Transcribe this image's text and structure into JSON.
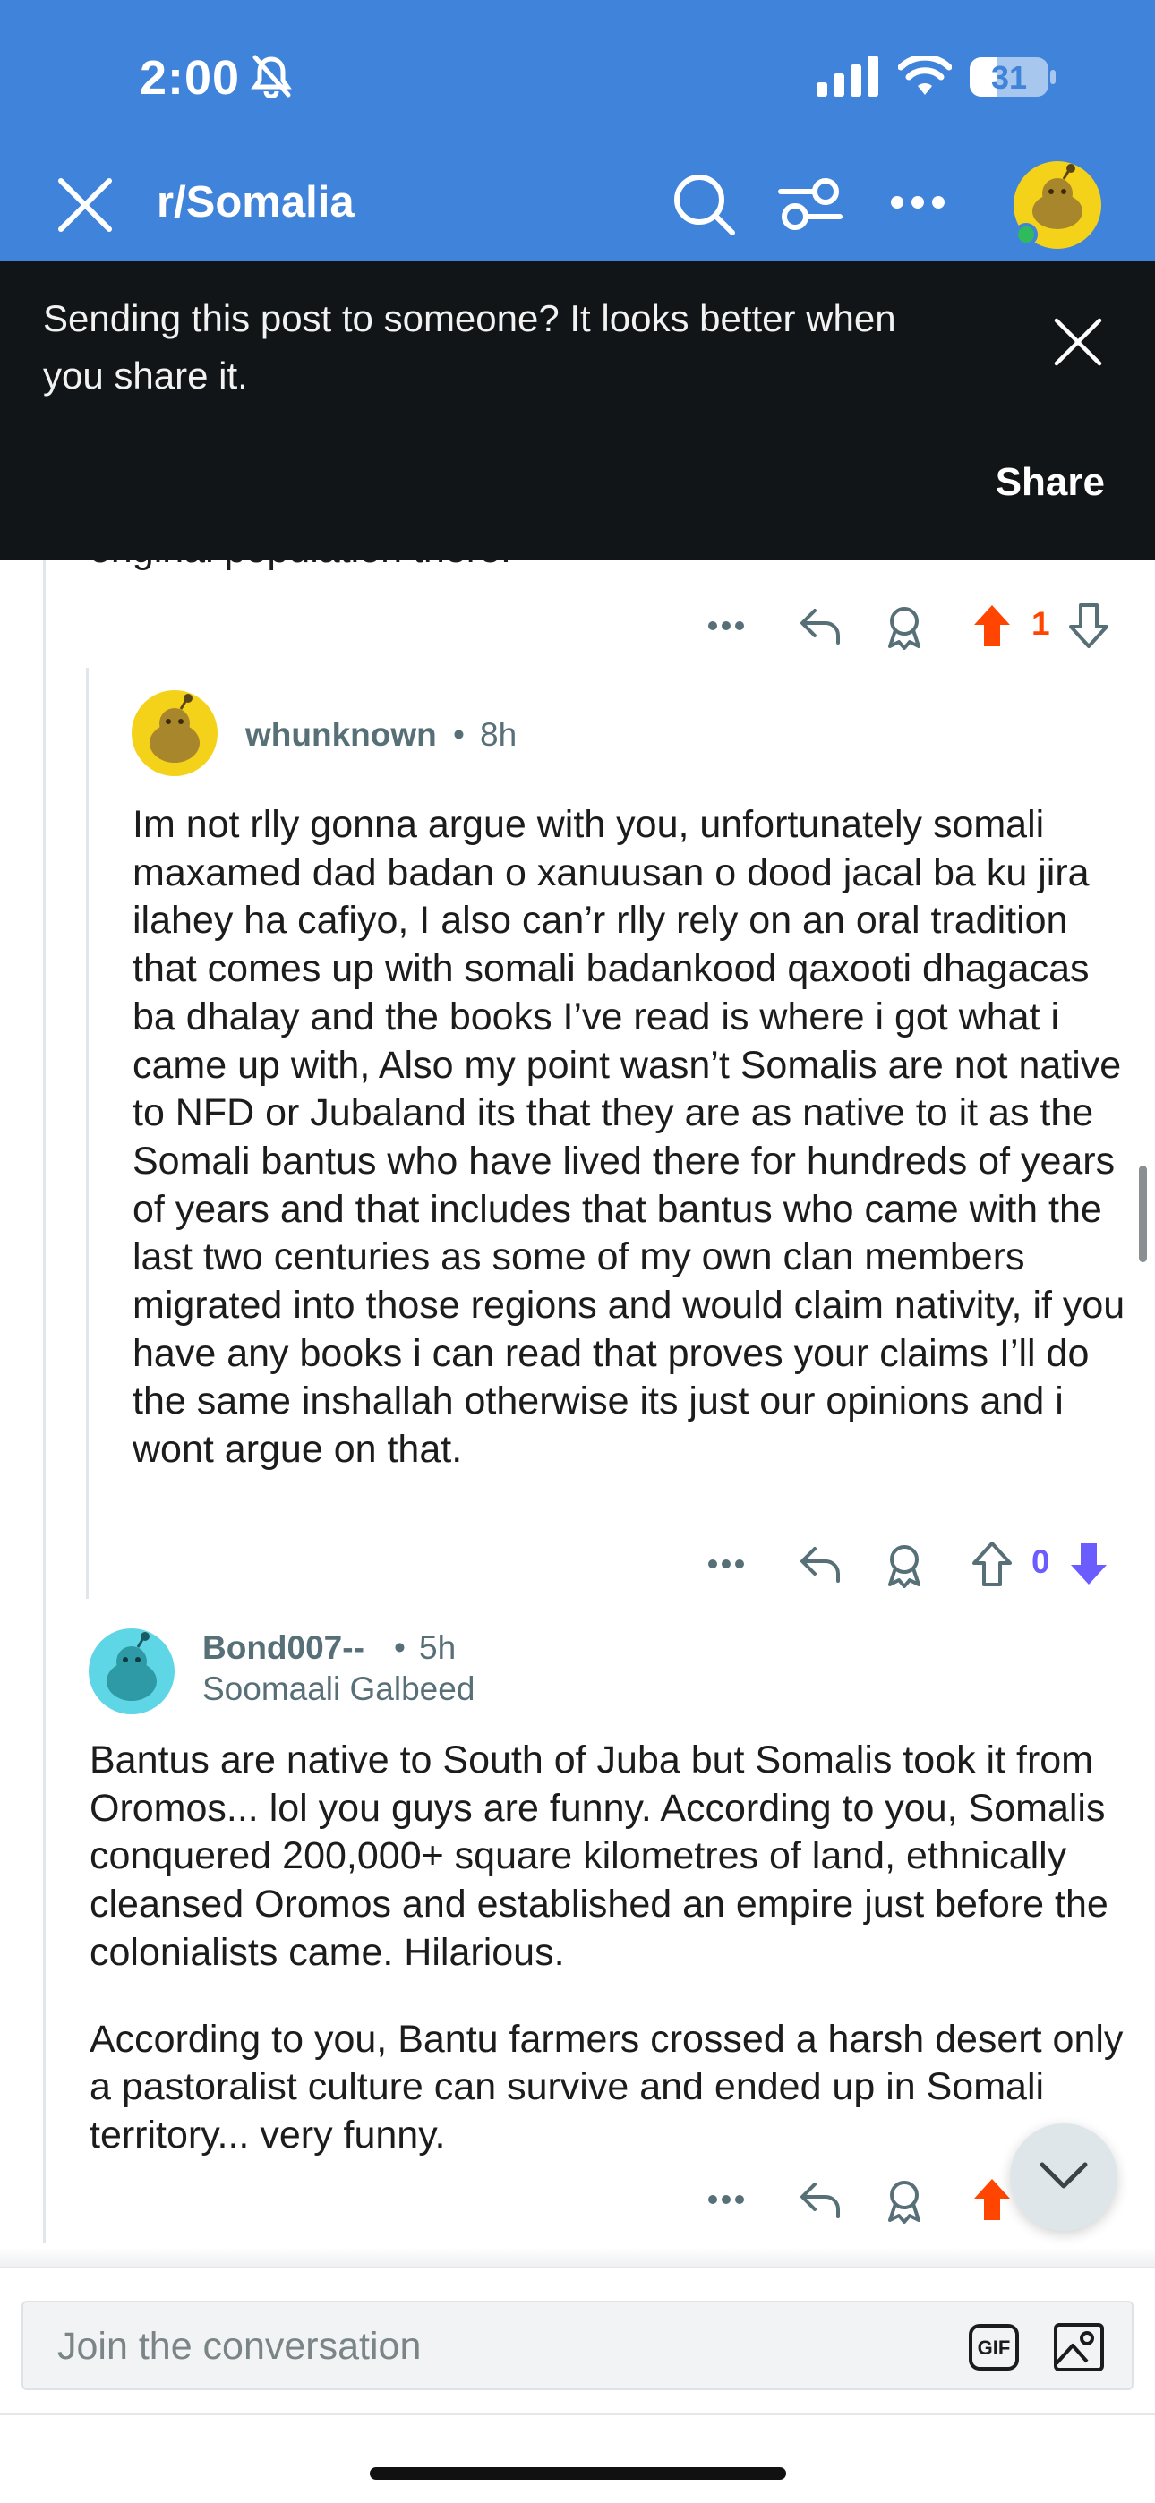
{
  "status_bar": {
    "time": "2:00",
    "battery": "31"
  },
  "header": {
    "title": "r/Somalia"
  },
  "banner": {
    "message": "Sending this post to someone? It looks better when you share it.",
    "share_label": "Share"
  },
  "prev_comment": {
    "partial_text": "original population there.",
    "vote_count": "1"
  },
  "comments": [
    {
      "username": "whunknown",
      "separator": "•",
      "time": "8h",
      "body": [
        "Im not rlly gonna argue with you, unfortunately somali maxamed dad badan o xanuusan o dood jacal ba ku jira ilahey ha cafiyo, I also can’r rlly rely on an oral tradition that comes up with somali badankood qaxooti dhagacas ba dhalay and the books I’ve read is where i got what i came up with, Also my point wasn’t Somalis are not native to NFD or Jubaland its that they are as native to it as the Somali bantus who have lived there for hundreds of years of years and that includes that bantus who came with the last two centuries as some of my own clan members migrated into those regions and would claim nativity, if you have any books i can read that proves your claims I’ll do the same inshallah otherwise its just our opinions and i wont argue on that."
      ],
      "vote_count": "0"
    },
    {
      "username": "Bond007--",
      "separator": "•",
      "time": "5h",
      "flair": "Soomaali Galbeed",
      "body": [
        "Bantus are native to South of Juba but Somalis took it from Oromos... lol you guys are funny. According to you, Somalis conquered 200,000+ square kilometres of land, ethnically cleansed Oromos and established an empire just before the colonialists came. Hilarious.",
        "According to you, Bantu farmers crossed a harsh desert only a pastoralist culture can survive and ended up in Somali territory... very funny."
      ]
    }
  ],
  "composer": {
    "placeholder": "Join the conversation",
    "gif_label": "GIF"
  },
  "colors": {
    "header_bg": "#3f83da",
    "banner_bg": "#121517",
    "upvote": "#ff4500",
    "downvote": "#6a5cff",
    "meta": "#576f76"
  }
}
